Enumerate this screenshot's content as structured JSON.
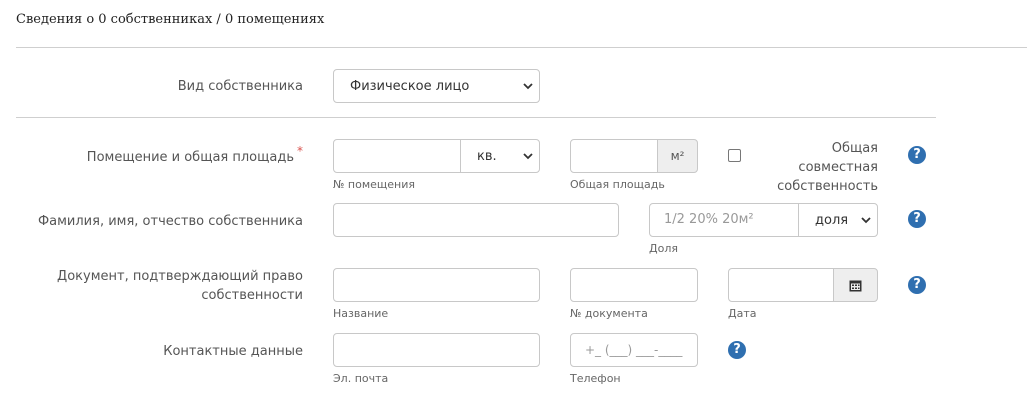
{
  "header": {
    "title": "Сведения о 0 собственниках / 0 помещениях"
  },
  "owner_type": {
    "label": "Вид собственника",
    "selected": "Физическое лицо"
  },
  "premises": {
    "label": "Помещение и общая площадь",
    "required_mark": "*",
    "number_value": "",
    "number_hint": "№ помещения",
    "type_selected": "кв.",
    "area_value": "",
    "area_unit": "м²",
    "area_hint": "Общая площадь",
    "joint_label_line1": "Общая совместная",
    "joint_label_line2": "собственность",
    "joint_checked": false
  },
  "owner_name": {
    "label": "Фамилия, имя, отчество собственника",
    "value": "",
    "share_placeholder": "1/2 20% 20м²",
    "share_unit_selected": "доля",
    "share_hint": "Доля"
  },
  "document": {
    "label_line1": "Документ, подтверждающий право",
    "label_line2": "собственности",
    "name_hint": "Название",
    "number_hint": "№ документа",
    "date_hint": "Дата"
  },
  "contacts": {
    "label": "Контактные данные",
    "email_value": "",
    "email_hint": "Эл. почта",
    "phone_placeholder": "+_ (___) ___-____",
    "phone_hint": "Телефон"
  },
  "help_glyph": "?"
}
